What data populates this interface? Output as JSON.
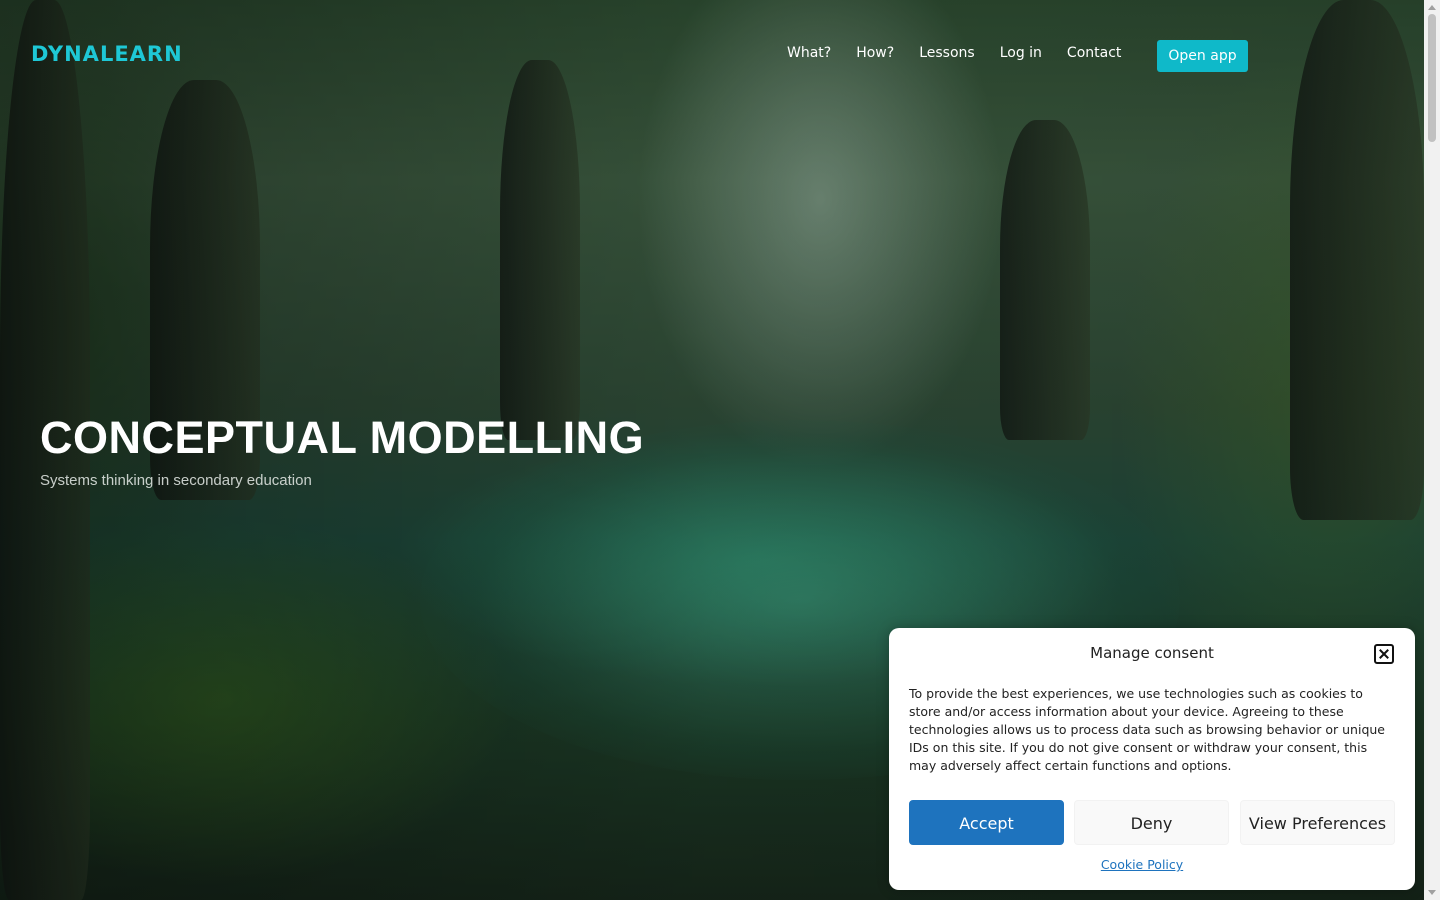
{
  "header": {
    "logo": "DYNALEARN",
    "nav": [
      "What?",
      "How?",
      "Lessons",
      "Log in",
      "Contact"
    ],
    "cta": "Open app"
  },
  "hero": {
    "title": "CONCEPTUAL MODELLING",
    "subtitle": "Systems thinking in secondary education"
  },
  "consent": {
    "title": "Manage consent",
    "body": "To provide the best experiences, we use technologies such as cookies to store and/or access information about your device. Agreeing to these technologies allows us to process data such as browsing behavior or unique IDs on this site. If you do not give consent or withdraw your consent, this may adversely affect certain functions and options.",
    "accept": "Accept",
    "deny": "Deny",
    "preferences": "View Preferences",
    "policy_link": "Cookie Policy"
  },
  "colors": {
    "brand": "#1ec8d6",
    "cta_bg": "#0fb9c9",
    "accept_bg": "#1e73be"
  }
}
